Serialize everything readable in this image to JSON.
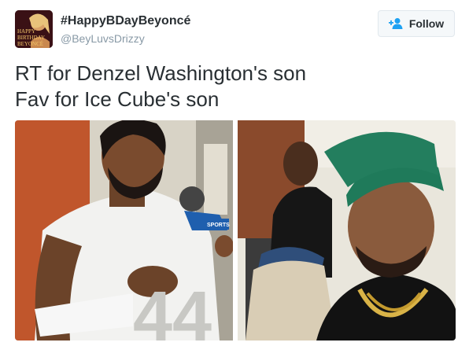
{
  "tweet": {
    "display_name": "#HappyBDayBeyoncé",
    "handle": "@BeyLuvsDrizzy",
    "follow_label": "Follow",
    "text": "RT for Denzel Washington's son\nFav for Ice Cube's son"
  },
  "avatar": {
    "text_lines": [
      "HAPPY",
      "BIRTHDAY",
      "BEYONCÉ"
    ]
  },
  "media": {
    "left": {
      "mic_logo": "SPORTS"
    },
    "right": {}
  },
  "colors": {
    "follow_icon": "#1da1f2",
    "text": "#292f33",
    "muted": "#8899a6"
  }
}
